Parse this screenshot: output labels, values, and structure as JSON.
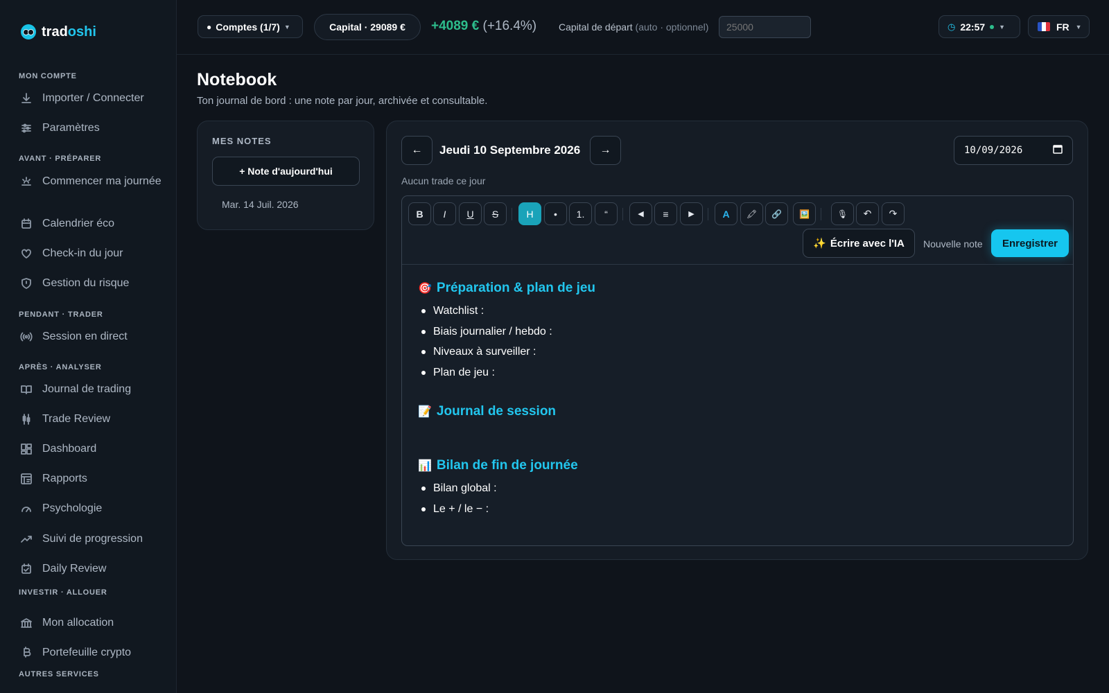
{
  "brand": {
    "name_part1": "trad",
    "name_part2": "oshi",
    "accent": "#22c6ee"
  },
  "sidebar": {
    "sections": [
      {
        "title": "MON COMPTE",
        "items": [
          {
            "label": "Importer / Connecter",
            "icon": "download-icon"
          },
          {
            "label": "Paramètres",
            "icon": "sliders-icon"
          }
        ]
      },
      {
        "title": "AVANT · PRÉPARER",
        "items": [
          {
            "label": "Commencer ma journée",
            "icon": "sunrise-icon"
          },
          {
            "label": "Calendrier éco",
            "icon": "calendar-icon"
          },
          {
            "label": "Check-in du jour",
            "icon": "heart-icon"
          },
          {
            "label": "Gestion du risque",
            "icon": "shield-icon"
          }
        ]
      },
      {
        "title": "PENDANT · TRADER",
        "items": [
          {
            "label": "Session en direct",
            "icon": "broadcast-icon"
          }
        ]
      },
      {
        "title": "APRÈS · ANALYSER",
        "items": [
          {
            "label": "Journal de trading",
            "icon": "book-icon"
          },
          {
            "label": "Trade Review",
            "icon": "candlestick-icon"
          },
          {
            "label": "Dashboard",
            "icon": "dashboard-icon"
          },
          {
            "label": "Rapports",
            "icon": "report-icon"
          },
          {
            "label": "Psychologie",
            "icon": "gauge-icon"
          },
          {
            "label": "Suivi de progression",
            "icon": "trending-up-icon"
          },
          {
            "label": "Daily Review",
            "icon": "calendar-check-icon"
          }
        ]
      },
      {
        "title": "INVESTIR · ALLOUER",
        "items": [
          {
            "label": "Mon allocation",
            "icon": "bank-icon"
          },
          {
            "label": "Portefeuille crypto",
            "icon": "bitcoin-icon"
          }
        ]
      },
      {
        "title": "AUTRES SERVICES",
        "items": []
      }
    ]
  },
  "topbar": {
    "accounts_label": "Comptes (1/7)",
    "capital_label": "Capital · 29089 €",
    "pnl_value": "+4089 €",
    "pnl_pct": "(+16.4%)",
    "capital_start_label": "Capital de départ",
    "capital_start_hint": "(auto · optionnel)",
    "capital_start_placeholder": "25000",
    "clock": "22:57",
    "lang": "FR",
    "colors": {
      "positive": "#2dbd8c"
    }
  },
  "page": {
    "title": "Notebook",
    "subtitle": "Ton journal de bord : une note par jour, archivée et consultable."
  },
  "notes": {
    "title": "MES NOTES",
    "today_button": "+ Note d'aujourd'hui",
    "items": [
      "Mar. 14 Juil. 2026"
    ]
  },
  "editor": {
    "prev": "←",
    "next": "→",
    "date_title": "Jeudi 10 Septembre 2026",
    "date_value": "10/09/2026",
    "no_trade": "Aucun trade ce jour",
    "toolbar": {
      "bold": "B",
      "italic": "I",
      "underline": "U",
      "strike": "S",
      "heading": "H",
      "bullet": "•",
      "ordered": "1.",
      "quote": "“",
      "align_left": "◀",
      "align_center": "≡",
      "align_right": "▶",
      "color": "A",
      "highlight": "🖍",
      "link": "🔗",
      "image": "🖼️",
      "mic": "🎙",
      "undo": "↶",
      "redo": "↷"
    },
    "ai_button": "Écrire avec l'IA",
    "ai_emoji": "✨",
    "new_note": "Nouvelle note",
    "save": "Enregistrer",
    "sections": [
      {
        "emoji": "🎯",
        "title": "Préparation & plan de jeu",
        "bullets": [
          "Watchlist :",
          "Biais journalier / hebdo :",
          "Niveaux à surveiller :",
          "Plan de jeu :"
        ]
      },
      {
        "emoji": "📝",
        "title": "Journal de session",
        "bullets": []
      },
      {
        "emoji": "📊",
        "title": "Bilan de fin de journée",
        "bullets": [
          "Bilan global :",
          "Le + / le − :"
        ]
      }
    ]
  }
}
